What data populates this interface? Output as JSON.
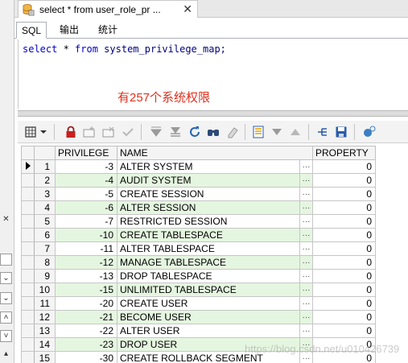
{
  "document_tab": {
    "title": "select * from user_role_pr ...",
    "close_glyph": "✕"
  },
  "subtabs": [
    {
      "label": "SQL",
      "active": true
    },
    {
      "label": "输出",
      "active": false
    },
    {
      "label": "统计",
      "active": false
    }
  ],
  "editor": {
    "tokens": {
      "kw1": "select",
      "star": " * ",
      "kw2": "from",
      "table": " system_privilege_map;"
    }
  },
  "annotation": "有257个系统权限",
  "colors": {
    "even_row": "#e5f6e0",
    "annotation": "#e0301e",
    "keyword": "#0000cc"
  },
  "toolbar_icons": [
    "grid-menu-icon",
    "lock-icon",
    "add-record-icon",
    "delete-record-icon",
    "post-check-icon",
    "first-record-icon",
    "last-record-icon",
    "refresh-icon",
    "find-icon",
    "clear-icon",
    "single-record-view-icon",
    "query-down-icon",
    "query-up-icon",
    "connect-icon",
    "save-icon",
    "export-icon"
  ],
  "grid": {
    "columns": [
      "PRIVILEGE",
      "NAME",
      "PROPERTY"
    ],
    "ellipsis": "···",
    "rows": [
      {
        "n": "1",
        "privilege": "-3",
        "name": "ALTER SYSTEM",
        "property": "0"
      },
      {
        "n": "2",
        "privilege": "-4",
        "name": "AUDIT SYSTEM",
        "property": "0"
      },
      {
        "n": "3",
        "privilege": "-5",
        "name": "CREATE SESSION",
        "property": "0"
      },
      {
        "n": "4",
        "privilege": "-6",
        "name": "ALTER SESSION",
        "property": "0"
      },
      {
        "n": "5",
        "privilege": "-7",
        "name": "RESTRICTED SESSION",
        "property": "0"
      },
      {
        "n": "6",
        "privilege": "-10",
        "name": "CREATE TABLESPACE",
        "property": "0"
      },
      {
        "n": "7",
        "privilege": "-11",
        "name": "ALTER TABLESPACE",
        "property": "0"
      },
      {
        "n": "8",
        "privilege": "-12",
        "name": "MANAGE TABLESPACE",
        "property": "0"
      },
      {
        "n": "9",
        "privilege": "-13",
        "name": "DROP TABLESPACE",
        "property": "0"
      },
      {
        "n": "10",
        "privilege": "-15",
        "name": "UNLIMITED TABLESPACE",
        "property": "0"
      },
      {
        "n": "11",
        "privilege": "-20",
        "name": "CREATE USER",
        "property": "0"
      },
      {
        "n": "12",
        "privilege": "-21",
        "name": "BECOME USER",
        "property": "0"
      },
      {
        "n": "13",
        "privilege": "-22",
        "name": "ALTER USER",
        "property": "0"
      },
      {
        "n": "14",
        "privilege": "-23",
        "name": "DROP USER",
        "property": "0"
      },
      {
        "n": "15",
        "privilege": "-30",
        "name": "CREATE ROLLBACK SEGMENT",
        "property": "0"
      }
    ]
  },
  "watermark": "https://blog.csdn.net/u010426739"
}
